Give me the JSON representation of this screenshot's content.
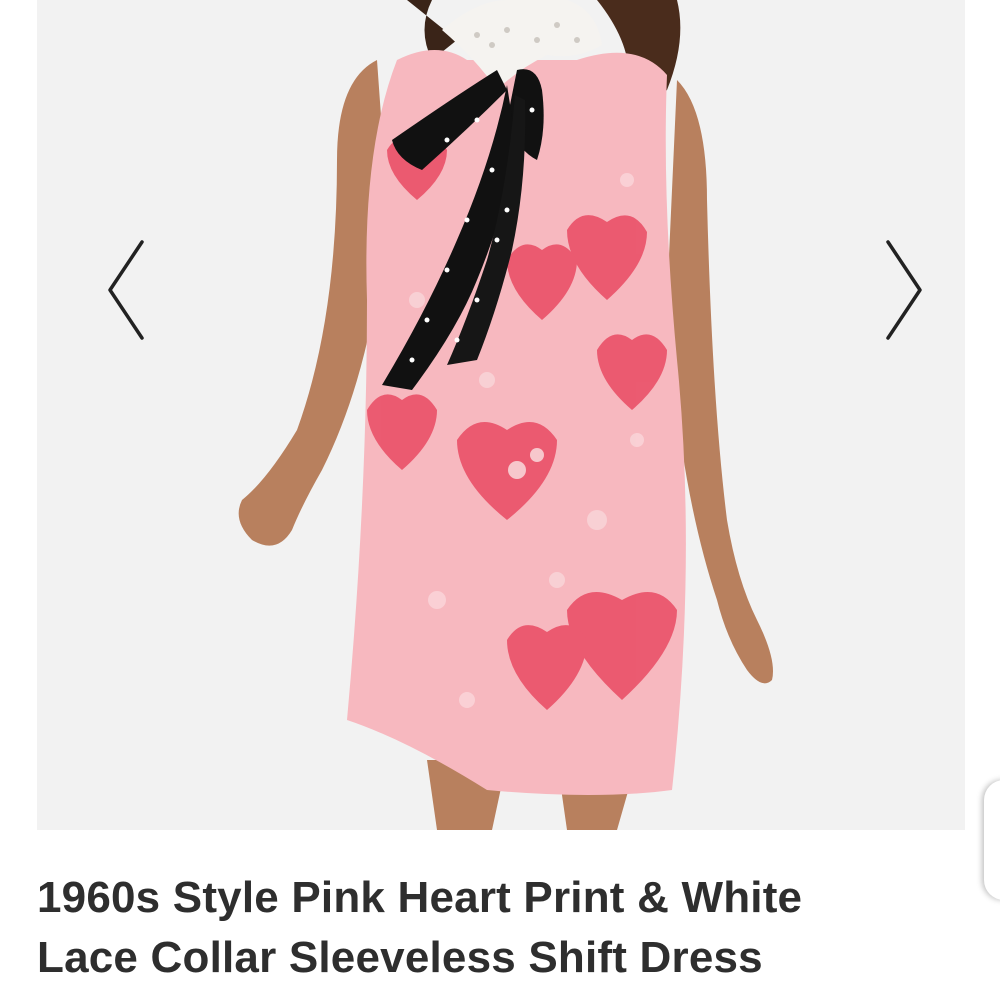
{
  "product": {
    "title_line1": "1960s Style Pink Heart Print & White",
    "title_line2": "Lace Collar Sleeveless Shift Dress"
  },
  "gallery": {
    "prev_icon": "chevron-left-icon",
    "next_icon": "chevron-right-icon"
  },
  "colors": {
    "background": "#ffffff",
    "gallery_background": "#f2f2f2",
    "title_text": "#2e2e2e",
    "dress_pink": "#f7b8bf",
    "dress_heart": "#e94a63",
    "bow_black": "#111111"
  }
}
